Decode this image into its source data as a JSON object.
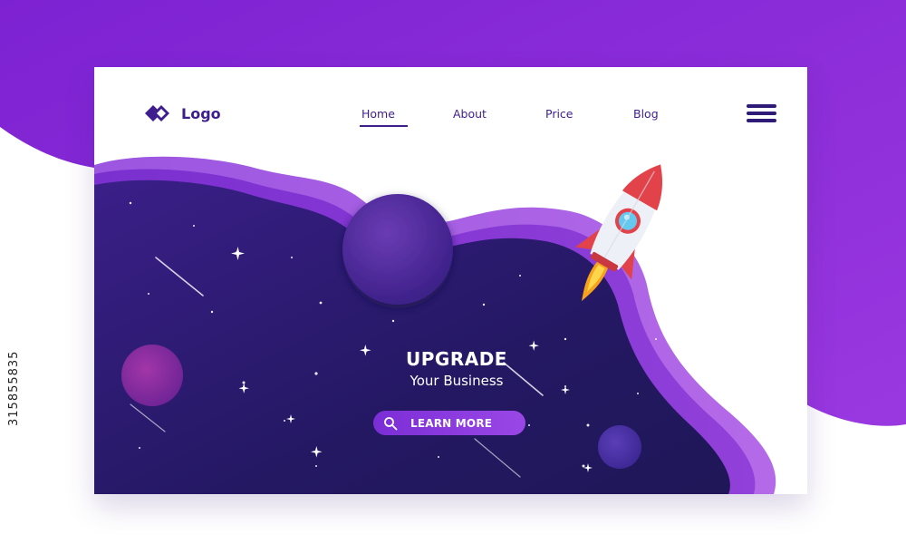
{
  "header": {
    "logo_label": "Logo",
    "logo_icon": "diamond-logo-icon"
  },
  "nav": {
    "items": [
      {
        "label": "Home",
        "active": true
      },
      {
        "label": "About",
        "active": false
      },
      {
        "label": "Price",
        "active": false
      },
      {
        "label": "Blog",
        "active": false
      }
    ],
    "menu_icon": "hamburger-menu-icon"
  },
  "hero": {
    "title": "UPGRADE",
    "subtitle": "Your Business",
    "cta_label": "LEARN MORE",
    "cta_icon": "search-icon",
    "illustration": "rocket-icon"
  },
  "watermark": {
    "stock_id": "315855835"
  },
  "colors": {
    "primary": "#3e1e8f",
    "accent": "#8a3ee0",
    "bg_purple": "#8b2fd8",
    "space": "#2b1a6b"
  }
}
